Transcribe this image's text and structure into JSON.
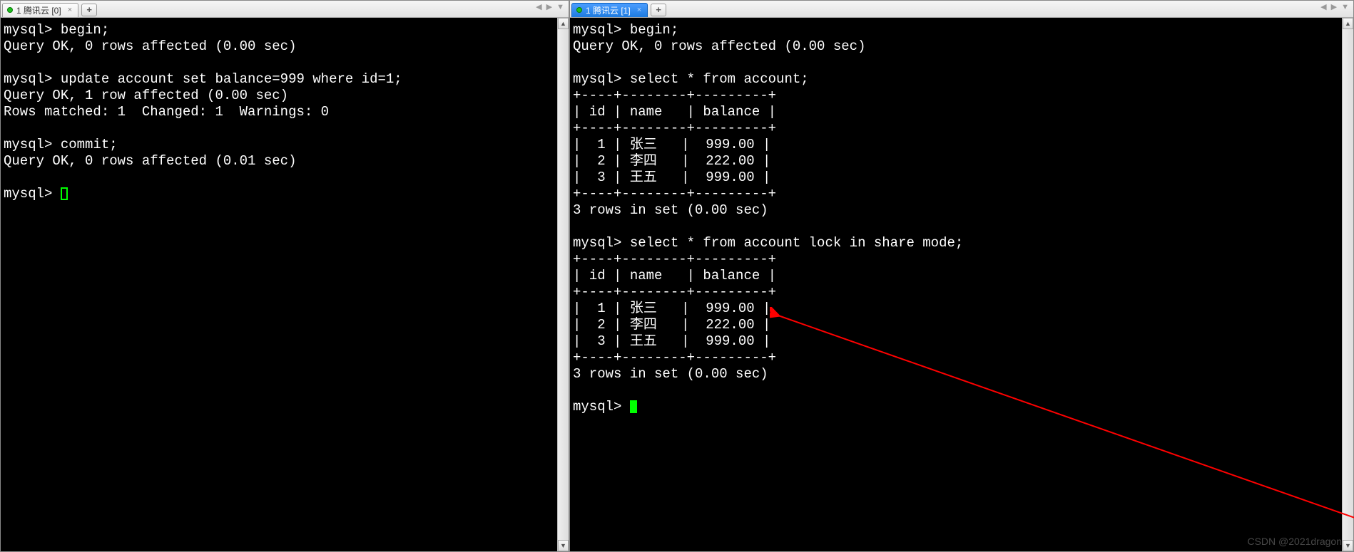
{
  "left": {
    "tab": {
      "title": "1 腾讯云 [0]"
    },
    "lines": [
      "mysql> begin;",
      "Query OK, 0 rows affected (0.00 sec)",
      "",
      "mysql> update account set balance=999 where id=1;",
      "Query OK, 1 row affected (0.00 sec)",
      "Rows matched: 1  Changed: 1  Warnings: 0",
      "",
      "mysql> commit;",
      "Query OK, 0 rows affected (0.01 sec)",
      "",
      "mysql> "
    ]
  },
  "right": {
    "tab": {
      "title": "1 腾讯云 [1]"
    },
    "lines": [
      "mysql> begin;",
      "Query OK, 0 rows affected (0.00 sec)",
      "",
      "mysql> select * from account;",
      "+----+--------+---------+",
      "| id | name   | balance |",
      "+----+--------+---------+",
      "|  1 | 张三   |  999.00 |",
      "|  2 | 李四   |  222.00 |",
      "|  3 | 王五   |  999.00 |",
      "+----+--------+---------+",
      "3 rows in set (0.00 sec)",
      "",
      "mysql> select * from account lock in share mode;",
      "+----+--------+---------+",
      "| id | name   | balance |",
      "+----+--------+---------+",
      "|  1 | 张三   |  999.00 |",
      "|  2 | 李四   |  222.00 |",
      "|  3 | 王五   |  999.00 |",
      "+----+--------+---------+",
      "3 rows in set (0.00 sec)",
      "",
      "mysql> "
    ]
  },
  "watermark": "CSDN @2021dragon",
  "glyphs": {
    "close": "×",
    "plus": "+",
    "left": "◀",
    "right": "▶",
    "down": "▼",
    "up": "▲"
  }
}
